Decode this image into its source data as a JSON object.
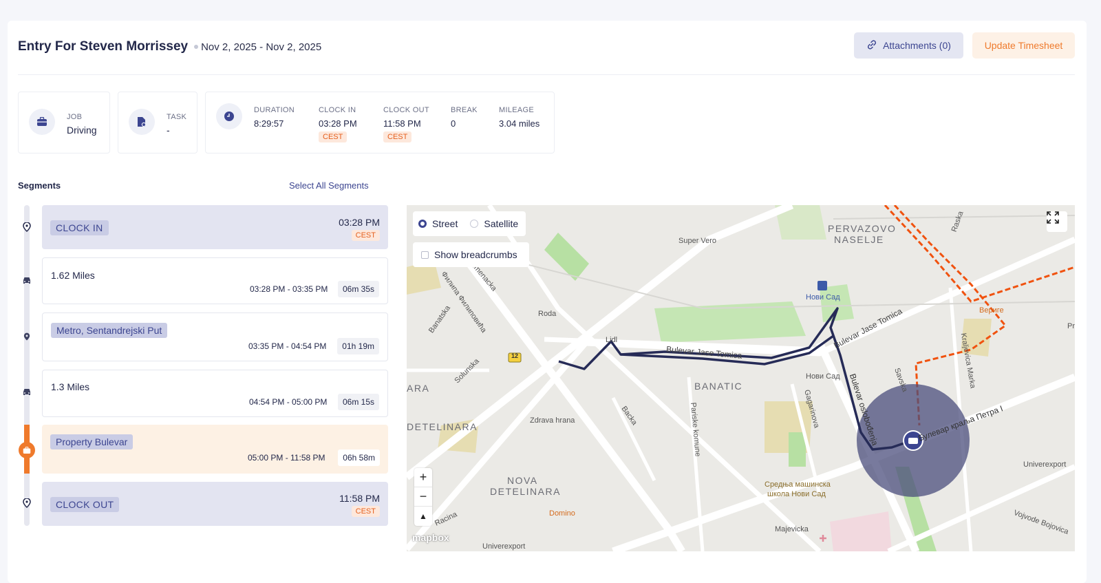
{
  "header": {
    "title": "Entry For Steven Morrissey",
    "date_range": "Nov 2, 2025 - Nov 2, 2025",
    "attachments_label": "Attachments (0)",
    "update_label": "Update Timesheet"
  },
  "info": {
    "job_label": "JOB",
    "job_value": "Driving",
    "task_label": "TASK",
    "task_value": "-",
    "duration_label": "DURATION",
    "duration_value": "8:29:57",
    "clock_in_label": "CLOCK IN",
    "clock_in_value": "03:28 PM",
    "clock_in_tz": "CEST",
    "clock_out_label": "CLOCK OUT",
    "clock_out_value": "11:58 PM",
    "clock_out_tz": "CEST",
    "break_label": "BREAK",
    "break_value": "0",
    "mileage_label": "MILEAGE",
    "mileage_value": "3.04 miles"
  },
  "segments": {
    "title": "Segments",
    "select_all": "Select All Segments",
    "items": [
      {
        "type": "clock",
        "label": "CLOCK IN",
        "time": "03:28 PM",
        "tz": "CEST"
      },
      {
        "type": "drive",
        "miles": "1.62 Miles",
        "range": "03:28 PM - 03:35 PM",
        "duration": "06m 35s"
      },
      {
        "type": "stop",
        "label": "Metro, Sentandrejski Put",
        "range": "03:35 PM - 04:54 PM",
        "duration": "01h 19m"
      },
      {
        "type": "drive",
        "miles": "1.3 Miles",
        "range": "04:54 PM - 05:00 PM",
        "duration": "06m 15s"
      },
      {
        "type": "job",
        "label": "Property Bulevar",
        "range": "05:00 PM - 11:58 PM",
        "duration": "06h 58m"
      },
      {
        "type": "clock",
        "label": "CLOCK OUT",
        "time": "11:58 PM",
        "tz": "CEST"
      }
    ]
  },
  "map": {
    "street_label": "Street",
    "satellite_label": "Satellite",
    "selected_layer": "Street",
    "breadcrumbs_label": "Show breadcrumbs",
    "zoom_in": "+",
    "zoom_out": "−",
    "compass": "▲",
    "logo": "mapbox",
    "labels": {
      "pervazovo": "PERVAZOVO",
      "naselje": "NASELJE",
      "super_vero": "Super Vero",
      "novi_sad_station": "Нови Сад",
      "novi_sad_2": "Нови Сад",
      "verige": "Вериге",
      "roda": "Roda",
      "lidl": "Lidl",
      "bulevar_jase_1": "Bulevar Jase Tomica",
      "bulevar_jase_2": "Bulevar Jase Tomica",
      "banatic": "BANATIC",
      "detelinara": "DETELINARA",
      "nova": "NOVA",
      "detelinara2": "DETELINARA",
      "ara": "ARA",
      "zdrava": "Zdrava hrana",
      "domino": "Domino",
      "srednja1": "Средња машинска",
      "srednja2": "школа Нови Сад",
      "majevicka": "Majevicka",
      "univerexport": "Univerexport",
      "univerexport2": "Univerexport",
      "vojvode": "Vojvode Bojovica",
      "raska": "Raska",
      "backa": "Backa",
      "parisk": "Pariske komune",
      "gagarinova": "Gagarinova",
      "banatska": "Banatska",
      "solunska": "Solunska",
      "rumenacka": "Rumenacka",
      "filipa": "Филипа Филиповића",
      "kraljevica": "Kraljevica Marka",
      "savska": "Savska",
      "bulevar_oslob": "Bulevar oslobođenja",
      "bulevar_petra": "Булевар краља Петра I",
      "road12": "12",
      "racina": "Racina",
      "pr": "Pr"
    },
    "colors": {
      "route": "#262b57",
      "route_dashed": "#f0520f",
      "geofence": "#4b4e7c",
      "accent": "#3c4590",
      "orange": "#ef7a2c"
    }
  }
}
